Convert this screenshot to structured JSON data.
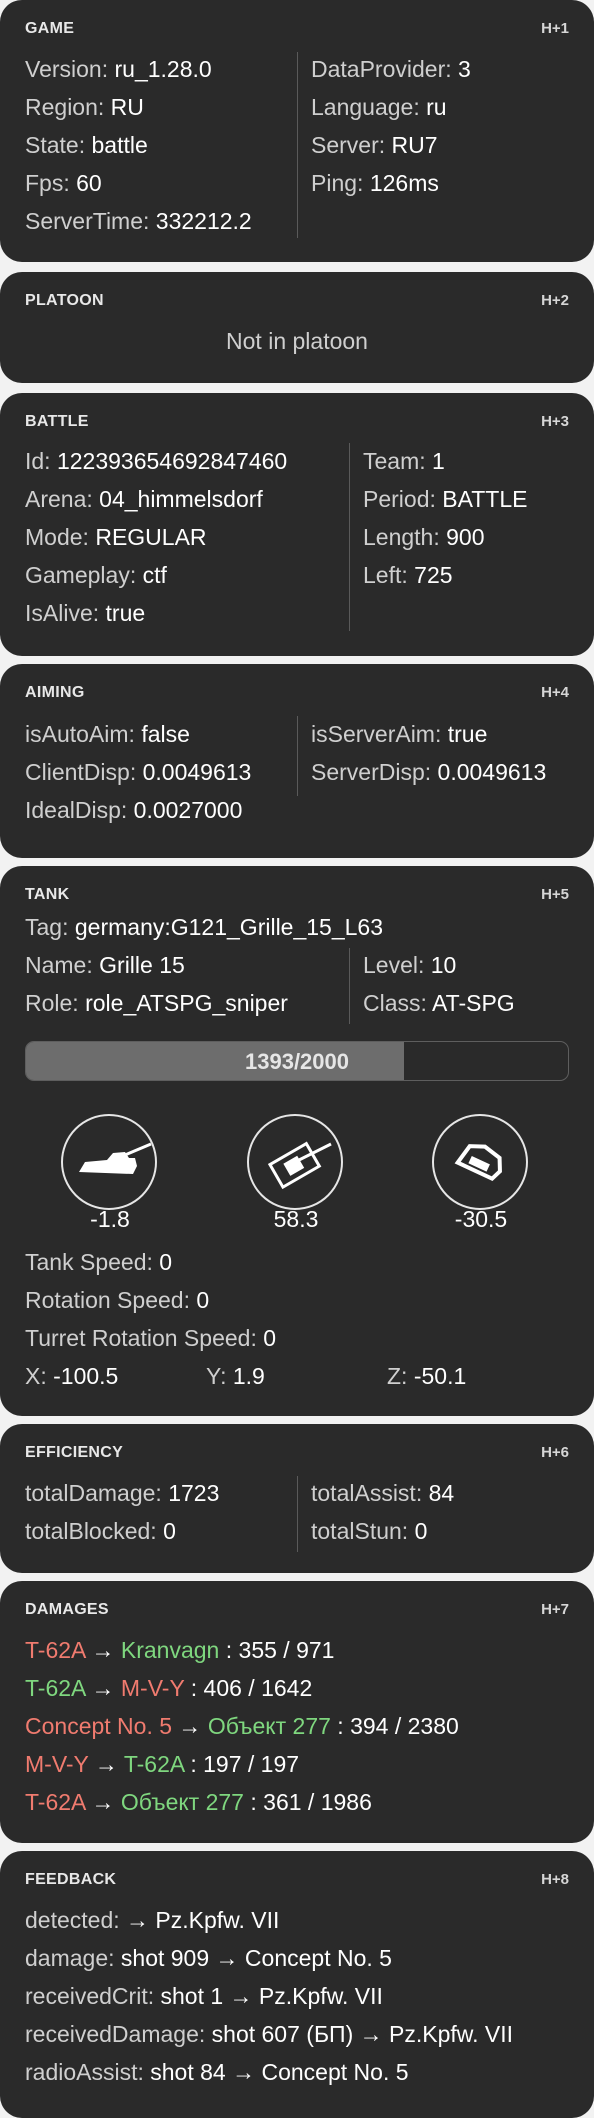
{
  "game": {
    "title": "GAME",
    "hotkey": "H+1",
    "left": [
      {
        "k": "Version:",
        "v": "ru_1.28.0"
      },
      {
        "k": "Region:",
        "v": "RU"
      },
      {
        "k": "State:",
        "v": "battle"
      },
      {
        "k": "Fps:",
        "v": "60"
      },
      {
        "k": "ServerTime:",
        "v": "332212.2"
      }
    ],
    "right": [
      {
        "k": "DataProvider:",
        "v": "3"
      },
      {
        "k": "Language:",
        "v": "ru"
      },
      {
        "k": "Server:",
        "v": "RU7"
      },
      {
        "k": "Ping:",
        "v": "126ms"
      }
    ]
  },
  "platoon": {
    "title": "PLATOON",
    "hotkey": "H+2",
    "status": "Not in platoon"
  },
  "battle": {
    "title": "BATTLE",
    "hotkey": "H+3",
    "left": [
      {
        "k": "Id:",
        "v": "122393654692847460"
      },
      {
        "k": "Arena:",
        "v": "04_himmelsdorf"
      },
      {
        "k": "Mode:",
        "v": "REGULAR"
      },
      {
        "k": "Gameplay:",
        "v": "ctf"
      },
      {
        "k": "IsAlive:",
        "v": "true"
      }
    ],
    "right": [
      {
        "k": "Team:",
        "v": "1"
      },
      {
        "k": "Period:",
        "v": "BATTLE"
      },
      {
        "k": "Length:",
        "v": "900"
      },
      {
        "k": "Left:",
        "v": "725"
      }
    ]
  },
  "aiming": {
    "title": "AIMING",
    "hotkey": "H+4",
    "left": [
      {
        "k": "isAutoAim:",
        "v": "false"
      },
      {
        "k": "ClientDisp:",
        "v": "0.0049613"
      },
      {
        "k": "IdealDisp:",
        "v": "0.0027000"
      }
    ],
    "right": [
      {
        "k": "isServerAim:",
        "v": "true"
      },
      {
        "k": "ServerDisp:",
        "v": "0.0049613"
      }
    ]
  },
  "tank": {
    "title": "TANK",
    "hotkey": "H+5",
    "tag": {
      "k": "Tag:",
      "v": "germany:G121_Grille_15_L63"
    },
    "name": {
      "k": "Name:",
      "v": "Grille 15"
    },
    "role": {
      "k": "Role:",
      "v": "role_ATSPG_sniper"
    },
    "level": {
      "k": "Level:",
      "v": "10"
    },
    "class": {
      "k": "Class:",
      "v": "AT-SPG"
    },
    "hp_text": "1393/2000",
    "hp_fraction": 0.6965,
    "angles": [
      "-1.8",
      "58.3",
      "-30.5"
    ],
    "tank_speed": {
      "k": "Tank Speed:",
      "v": "0"
    },
    "rotation_speed": {
      "k": "Rotation Speed:",
      "v": "0"
    },
    "turret_rotation_speed": {
      "k": "Turret Rotation Speed:",
      "v": "0"
    },
    "x": {
      "k": "X:",
      "v": "-100.5"
    },
    "y": {
      "k": "Y:",
      "v": "1.9"
    },
    "z": {
      "k": "Z:",
      "v": "-50.1"
    }
  },
  "efficiency": {
    "title": "EFFICIENCY",
    "hotkey": "H+6",
    "left": [
      {
        "k": "totalDamage:",
        "v": "1723"
      },
      {
        "k": "totalBlocked:",
        "v": "0"
      }
    ],
    "right": [
      {
        "k": "totalAssist:",
        "v": "84"
      },
      {
        "k": "totalStun:",
        "v": "0"
      }
    ]
  },
  "damages": {
    "title": "DAMAGES",
    "hotkey": "H+7",
    "arrow": "→",
    "rows": [
      {
        "from": "T-62A",
        "from_color": "#f07b6f",
        "to": "Kranvagn",
        "to_color": "#7fd77f",
        "value": ": 355 / 971"
      },
      {
        "from": "T-62A",
        "from_color": "#7fd77f",
        "to": "M-V-Y",
        "to_color": "#f07b6f",
        "value": ": 406 / 1642"
      },
      {
        "from": "Concept No. 5",
        "from_color": "#f07b6f",
        "to": "Объект 277",
        "to_color": "#7fd77f",
        "value": ": 394 / 2380"
      },
      {
        "from": "M-V-Y",
        "from_color": "#f07b6f",
        "to": "T-62A",
        "to_color": "#7fd77f",
        "value": ": 197 / 197"
      },
      {
        "from": "T-62A",
        "from_color": "#f07b6f",
        "to": "Объект 277",
        "to_color": "#7fd77f",
        "value": ": 361 / 1986"
      }
    ]
  },
  "feedback": {
    "title": "FEEDBACK",
    "hotkey": "H+8",
    "rows": [
      {
        "k": "detected:",
        "v": "→ Pz.Kpfw. VII"
      },
      {
        "k": "damage:",
        "v": "shot 909 → Concept No. 5"
      },
      {
        "k": "receivedCrit:",
        "v": "shot 1 → Pz.Kpfw. VII"
      },
      {
        "k": "receivedDamage:",
        "v": "shot 607 (БП) → Pz.Kpfw. VII"
      },
      {
        "k": "radioAssist:",
        "v": "shot 84 → Concept No. 5"
      }
    ]
  }
}
